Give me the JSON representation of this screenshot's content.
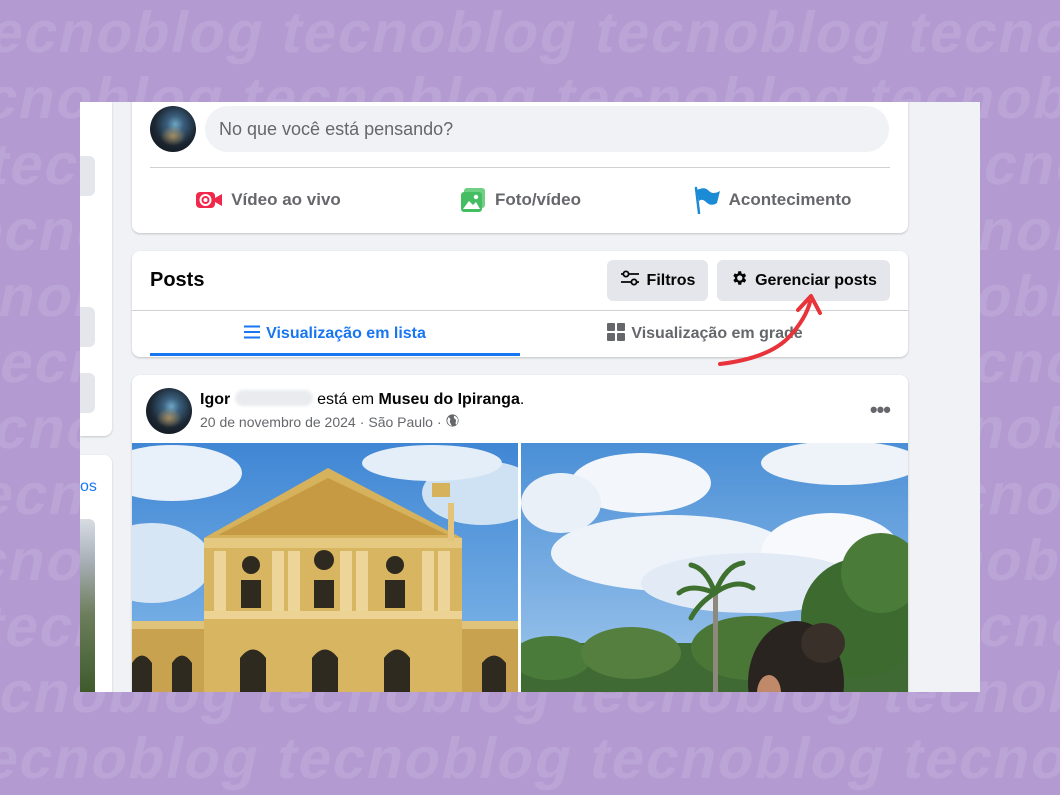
{
  "composer": {
    "placeholder": "No que você está pensando?",
    "actions": [
      {
        "label": "Vídeo ao vivo",
        "icon": "live-video-icon",
        "color": "#f02849"
      },
      {
        "label": "Foto/vídeo",
        "icon": "photo-video-icon",
        "color": "#45bd62"
      },
      {
        "label": "Acontecimento",
        "icon": "flag-icon",
        "color": "#1b8bd6"
      }
    ]
  },
  "left_column": {
    "link_text": "os"
  },
  "posts_section": {
    "title": "Posts",
    "filter_button": {
      "label": "Filtros",
      "icon": "sliders-icon"
    },
    "manage_button": {
      "label": "Gerenciar posts",
      "icon": "gear-icon"
    },
    "tabs": [
      {
        "label": "Visualização em lista",
        "icon": "list-icon",
        "active": true
      },
      {
        "label": "Visualização em grade",
        "icon": "grid-icon",
        "active": false
      }
    ]
  },
  "post": {
    "author_first": "Igor",
    "author_connector": "está em",
    "place": "Museu do Ipiranga",
    "place_suffix": ".",
    "date": "20 de novembro de 2024",
    "location": "São Paulo",
    "separator": "·",
    "privacy_icon": "globe-icon",
    "more_label": "•••"
  },
  "colors": {
    "accent": "#1876f2",
    "annotation_arrow": "#e8333b",
    "background": "#b39bd2"
  }
}
